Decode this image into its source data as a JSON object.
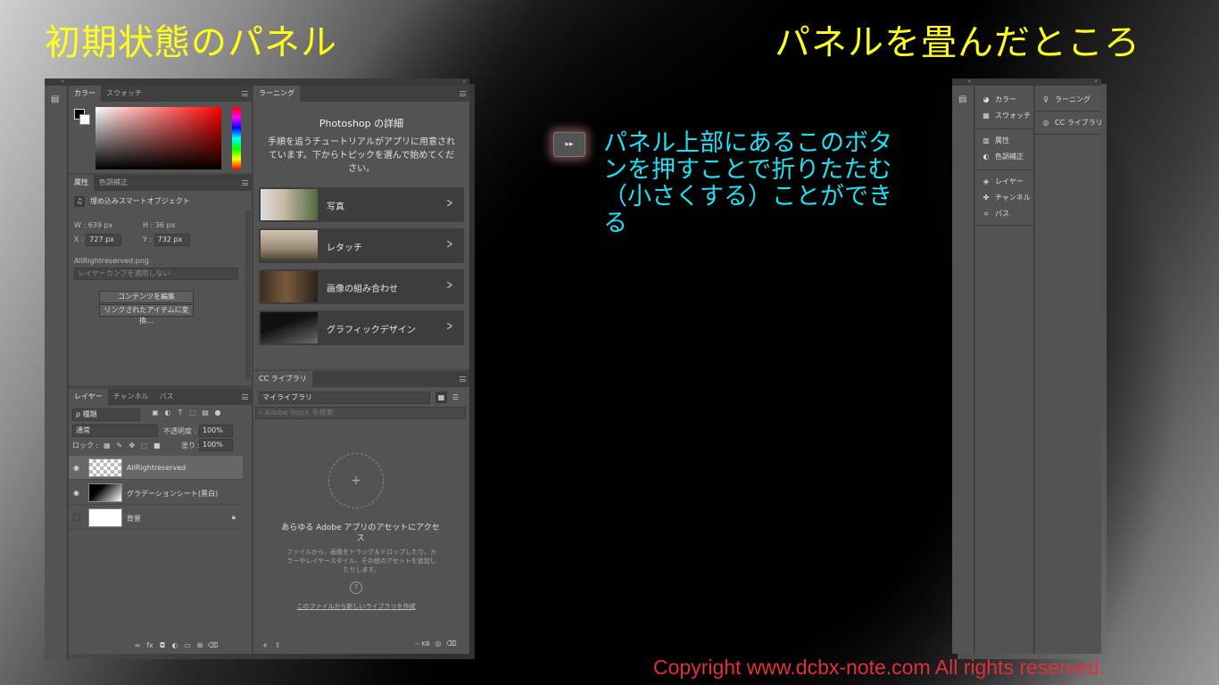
{
  "headings": {
    "left": "初期状態のパネル",
    "right": "パネルを畳んだところ"
  },
  "note": {
    "button_glyph": "▸▸",
    "text": "パネル上部にあるこのボタンを押すことで折りたたむ（小さくする）ことができる"
  },
  "copyright": "Copyright www.dcbx-note.com All rights reserved.",
  "panel_top_collapse": "«",
  "color_panel": {
    "tabs": [
      "カラー",
      "スウォッチ"
    ]
  },
  "properties_panel": {
    "tabs": [
      "属性",
      "色調補正"
    ],
    "type_label": "埋め込みスマートオブジェクト",
    "w_label": "W :",
    "w_value": "639 px",
    "h_label": "H :",
    "h_value": "36 px",
    "x_label": "X :",
    "x_value": "727 px",
    "y_label": "Y :",
    "y_value": "732 px",
    "filename": "AllRightreserved.png",
    "layer_comp_placeholder": "レイヤーカンプを適用しない",
    "edit_contents_button": "コンテンツを編集",
    "convert_linked_button": "リンクされたアイテムに変換..."
  },
  "learning_panel": {
    "tab": "ラーニング",
    "title": "Photoshop の詳細",
    "description": "手順を追うチュートリアルがアプリに用意されています。下からトピックを選んで始めてください。",
    "items": [
      "写真",
      "レタッチ",
      "画像の組み合わせ",
      "グラフィックデザイン"
    ]
  },
  "layers_panel": {
    "tabs": [
      "レイヤー",
      "チャンネル",
      "パス"
    ],
    "filter_kind": "ρ 種類",
    "blend_mode": "通常",
    "opacity_label": "不透明度 :",
    "opacity_value": "100%",
    "lock_label": "ロック :",
    "fill_label": "塗り :",
    "fill_value": "100%",
    "layers": [
      "AllRightreserved",
      "グラデーションシート(黒白)",
      "背景"
    ]
  },
  "cc_libraries_panel": {
    "tab": "CC ライブラリ",
    "library_select": "マイライブラリ",
    "search_placeholder": "Adobe Stock を検索",
    "empty_title": "あらゆる Adobe アプリのアセットにアクセス",
    "empty_desc": "ファイルから、画像をドラッグ＆ドロップしたり、カラーやレイヤースタイル、その他のアセットを追加したりします。",
    "create_link": "このファイルから新しいライブラリを作成",
    "size_label": "-- KB"
  },
  "collapsed_panel": {
    "col1": [
      "カラー",
      "スウォッチ",
      "属性",
      "色調補正",
      "レイヤー",
      "チャンネル",
      "パス"
    ],
    "col2": [
      "ラーニング",
      "CC ライブラリ"
    ]
  }
}
